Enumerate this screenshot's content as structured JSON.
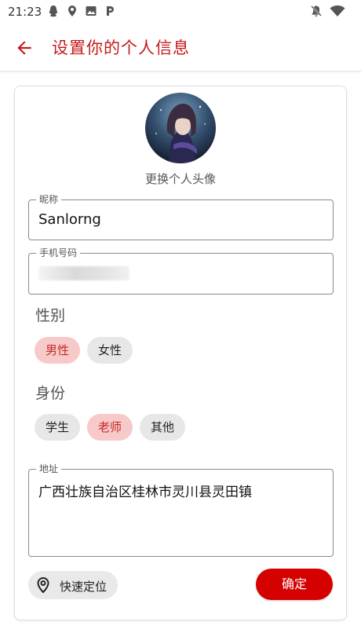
{
  "status_bar": {
    "time": "21:23",
    "icons": [
      "qq-icon",
      "location-icon",
      "image-icon",
      "p-icon",
      "notifications-off-icon",
      "wifi-icon"
    ]
  },
  "app_bar": {
    "title": "设置你的个人信息",
    "accent_color": "#c61a1a"
  },
  "profile": {
    "change_avatar_label": "更换个人头像"
  },
  "nickname": {
    "label": "昵称",
    "value": "Sanlorng"
  },
  "phone": {
    "label": "手机号码"
  },
  "gender": {
    "title": "性别",
    "options": [
      {
        "label": "男性",
        "selected": true
      },
      {
        "label": "女性",
        "selected": false
      }
    ]
  },
  "identity": {
    "title": "身份",
    "options": [
      {
        "label": "学生",
        "selected": false
      },
      {
        "label": "老师",
        "selected": true
      },
      {
        "label": "其他",
        "selected": false
      }
    ]
  },
  "address": {
    "label": "地址",
    "value": "广西壮族自治区桂林市灵川县灵田镇"
  },
  "actions": {
    "locate_label": "快速定位",
    "confirm_label": "确定",
    "confirm_color": "#d50000"
  }
}
